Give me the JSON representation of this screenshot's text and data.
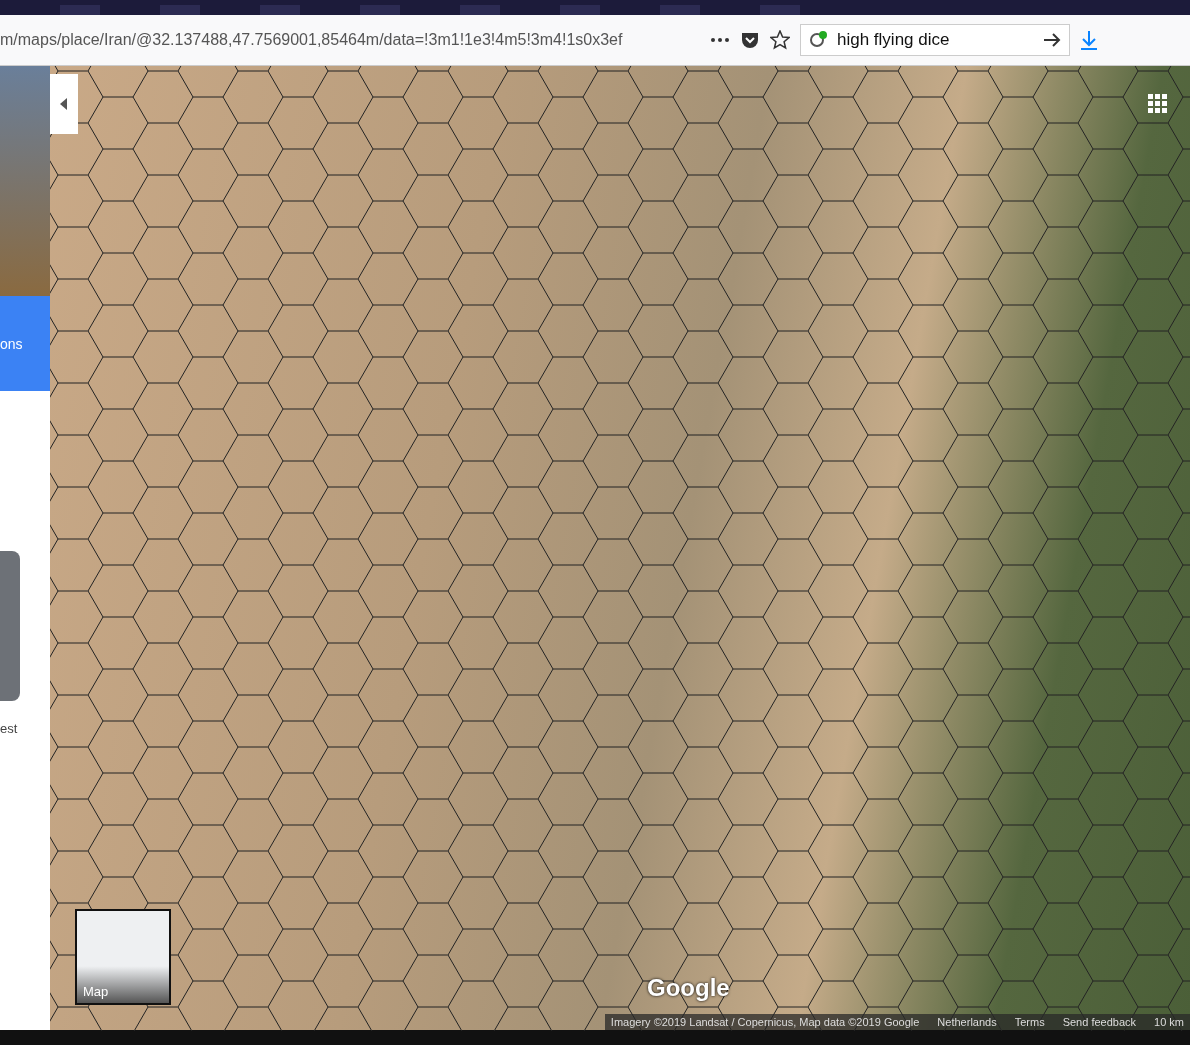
{
  "browser": {
    "address": "m/maps/place/Iran/@32.137488,47.7569001,85464m/data=!3m1!1e3!4m5!3m4!1s0x3ef",
    "search": {
      "value": "high flying dice"
    }
  },
  "side_panel": {
    "directions_button": "ons",
    "item_text": "est"
  },
  "map": {
    "layer_switch": "Map",
    "logo": "Google",
    "footer": [
      "Imagery ©2019 Landsat / Copernicus, Map data ©2019 Google",
      "Netherlands",
      "Terms",
      "Send feedback"
    ],
    "scale": "10 km"
  }
}
